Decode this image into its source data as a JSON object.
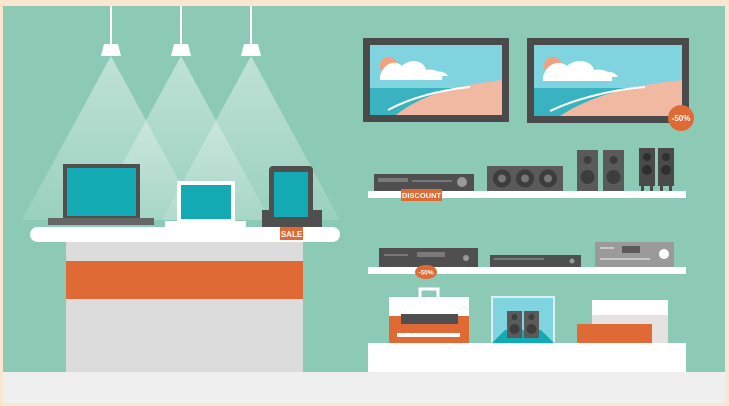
{
  "labels": {
    "sale": "SALE",
    "discount": "DISCOUNT",
    "tv_badge": "-50%",
    "shelf_badge": "-50%"
  },
  "colors": {
    "wall": "#8ccab5",
    "floor": "#efefef",
    "frame": "#fbe6cf",
    "accent": "#e06a35",
    "counter": "#dcdcdc",
    "shelf": "#ffffff",
    "device_dark": "#4f4f4f",
    "screen_teal": "#13aab4",
    "sea": "#39b3c0",
    "sand": "#f1b9a1",
    "sky": "#7fd4e0"
  },
  "icons": [
    "pendant-lamp-icon",
    "laptop-icon",
    "tablet-icon",
    "tv-icon",
    "dvd-player-icon",
    "center-speaker-icon",
    "bookshelf-speaker-icon",
    "tower-speaker-icon",
    "receiver-icon",
    "gift-box-icon"
  ]
}
